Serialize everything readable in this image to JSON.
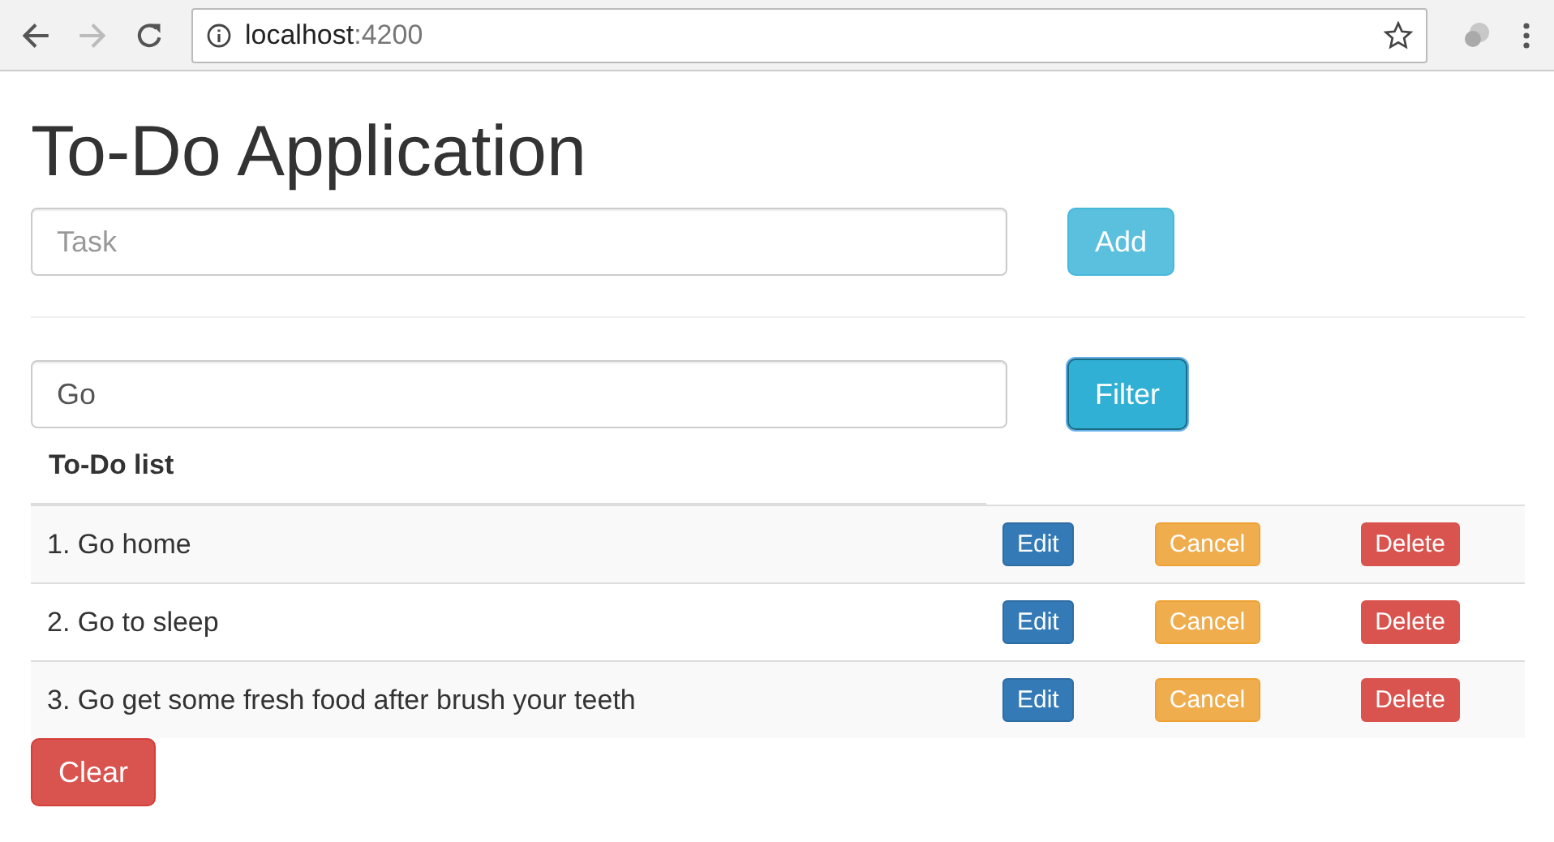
{
  "browser": {
    "host": "localhost",
    "port": ":4200"
  },
  "title": "To-Do Application",
  "task": {
    "placeholder": "Task",
    "button": "Add"
  },
  "filter": {
    "value": "Go",
    "button": "Filter",
    "focused": true
  },
  "table": {
    "heading": "To-Do list",
    "rows": [
      {
        "text": "1. Go home",
        "actions": [
          {
            "label": "Edit",
            "kind": "primary"
          },
          {
            "label": "Cancel",
            "kind": "warning"
          },
          {
            "label": "Delete",
            "kind": "danger"
          }
        ]
      },
      {
        "text": "2. Go to sleep",
        "actions": [
          {
            "label": "Edit",
            "kind": "primary"
          },
          {
            "label": "Cancel",
            "kind": "warning"
          },
          {
            "label": "Delete",
            "kind": "danger"
          }
        ]
      },
      {
        "text": "3. Go get some fresh food after brush your teeth",
        "actions": [
          {
            "label": "Edit",
            "kind": "primary"
          },
          {
            "label": "Cancel",
            "kind": "warning"
          },
          {
            "label": "Delete",
            "kind": "danger"
          }
        ]
      }
    ]
  },
  "clear_button": "Clear"
}
